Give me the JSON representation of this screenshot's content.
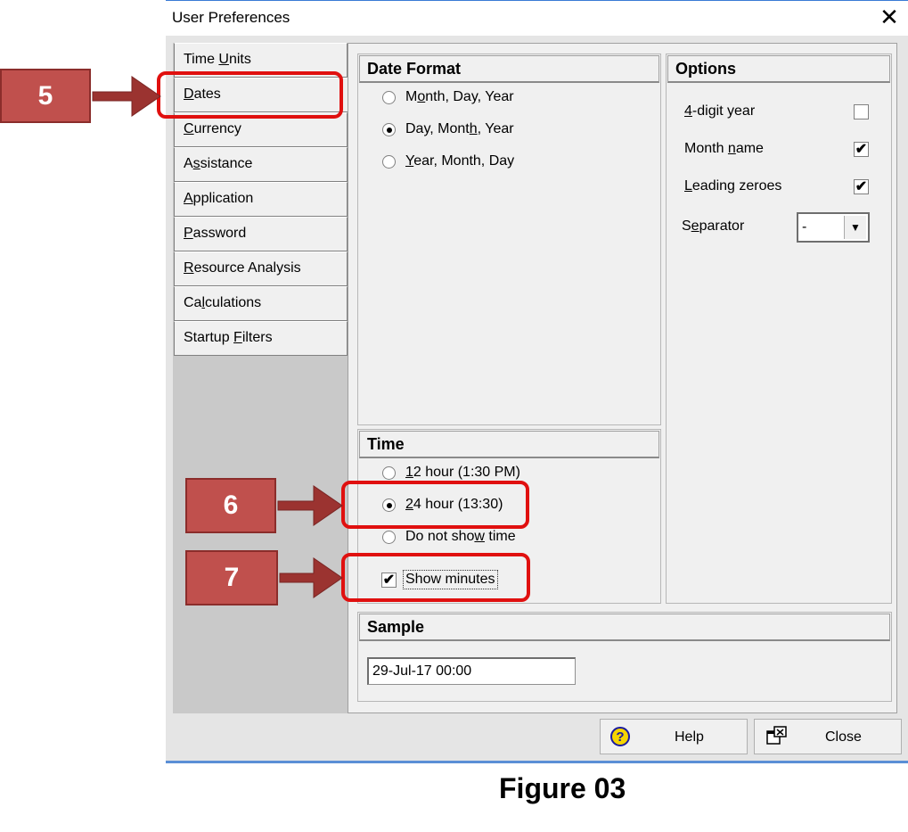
{
  "window": {
    "title": "User Preferences",
    "close_glyph": "✕"
  },
  "tabs": [
    {
      "pre": "Time ",
      "ul": "U",
      "post": "nits"
    },
    {
      "pre": "",
      "ul": "D",
      "post": "ates"
    },
    {
      "pre": "",
      "ul": "C",
      "post": "urrency"
    },
    {
      "pre": "A",
      "ul": "s",
      "post": "sistance"
    },
    {
      "pre": "",
      "ul": "A",
      "post": "pplication"
    },
    {
      "pre": "",
      "ul": "P",
      "post": "assword"
    },
    {
      "pre": "",
      "ul": "R",
      "post": "esource Analysis"
    },
    {
      "pre": "Ca",
      "ul": "l",
      "post": "culations"
    },
    {
      "pre": "Startup ",
      "ul": "F",
      "post": "ilters"
    }
  ],
  "date_format": {
    "heading": "Date Format",
    "options": [
      {
        "pre": "M",
        "ul": "o",
        "post": "nth, Day, Year",
        "selected": false
      },
      {
        "pre": "Day, Mont",
        "ul": "h",
        "post": ", Year",
        "selected": true
      },
      {
        "pre": "",
        "ul": "Y",
        "post": "ear, Month, Day",
        "selected": false
      }
    ]
  },
  "options": {
    "heading": "Options",
    "four_digit": {
      "pre": "",
      "ul": "4",
      "post": "-digit year",
      "checked": false
    },
    "month_name": {
      "pre": "Month ",
      "ul": "n",
      "post": "ame",
      "checked": true
    },
    "leading_zeroes": {
      "pre": "",
      "ul": "L",
      "post": "eading zeroes",
      "checked": true
    },
    "separator": {
      "pre": "S",
      "ul": "e",
      "post": "parator",
      "value": "-"
    }
  },
  "time": {
    "heading": "Time",
    "options": [
      {
        "pre": "",
        "ul": "1",
        "post": "2 hour (1:30 PM)",
        "selected": false
      },
      {
        "pre": "",
        "ul": "2",
        "post": "4 hour (13:30)",
        "selected": true
      },
      {
        "pre": "Do not sho",
        "ul": "w",
        "post": " time",
        "selected": false
      }
    ],
    "show_minutes": {
      "label": "Show minutes",
      "checked": true
    }
  },
  "sample": {
    "heading": "Sample",
    "value": "29-Jul-17 00:00"
  },
  "buttons": {
    "help": "Help",
    "close": "Close"
  },
  "callouts": [
    "5",
    "6",
    "7"
  ],
  "caption": "Figure 03",
  "colors": {
    "callout": "#c0504d",
    "highlight": "#e0100f",
    "arrow": "#9b3330"
  }
}
